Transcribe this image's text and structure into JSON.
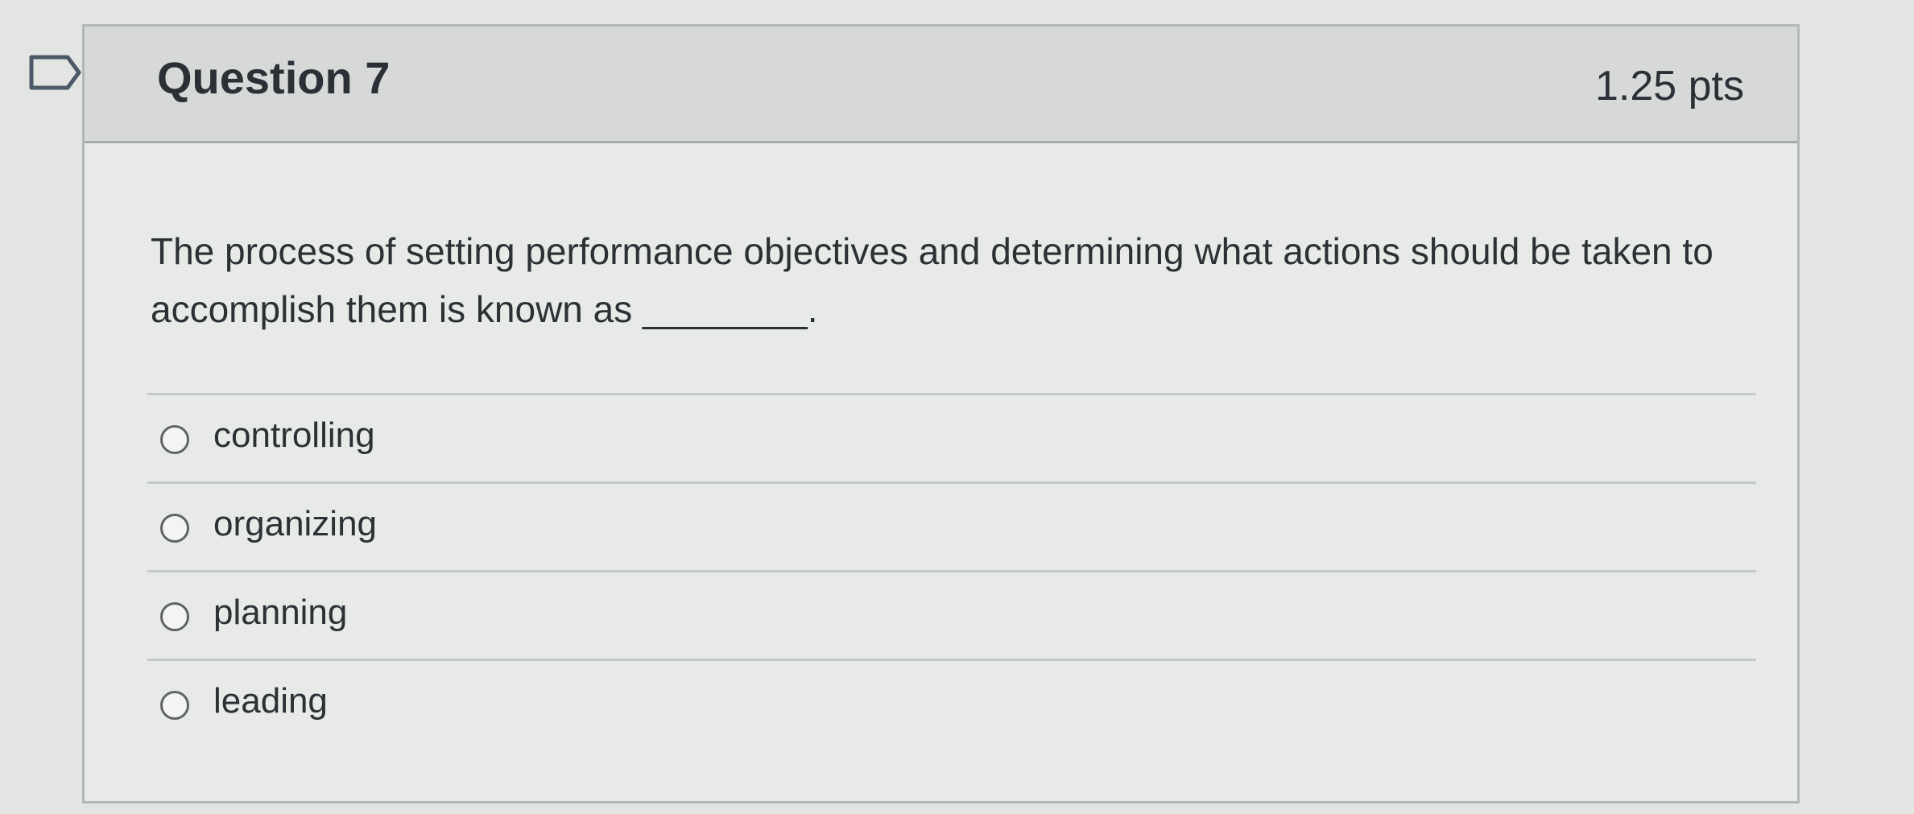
{
  "question": {
    "title": "Question 7",
    "points": "1.25 pts",
    "text": "The process of setting performance objectives and determining what actions should be taken to accomplish them is known as ________.",
    "answers": [
      {
        "label": "controlling"
      },
      {
        "label": "organizing"
      },
      {
        "label": "planning"
      },
      {
        "label": "leading"
      }
    ]
  },
  "icons": {
    "bookmark": "bookmark-icon",
    "radio": "radio-button-icon"
  }
}
